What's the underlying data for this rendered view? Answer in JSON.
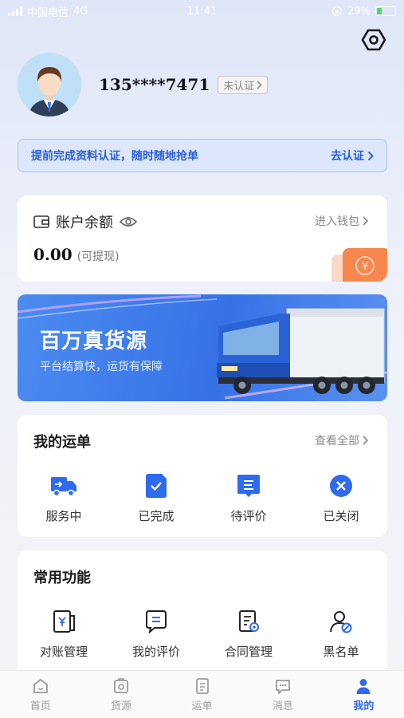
{
  "status": {
    "carrier": "中国电信",
    "network": "4G",
    "time": "11:41",
    "battery": "29%"
  },
  "profile": {
    "phone": "135****7471",
    "verify_label": "未认证"
  },
  "notice": {
    "text": "提前完成资料认证，随时随地抢单",
    "link": "去认证"
  },
  "balance": {
    "title": "账户余额",
    "wallet_link": "进入钱包",
    "amount": "0.00",
    "note": "(可提现)"
  },
  "banner": {
    "title": "百万真货源",
    "subtitle": "平台结算快，运货有保障"
  },
  "orders": {
    "title": "我的运单",
    "view_all": "查看全部",
    "items": [
      {
        "label": "服务中",
        "icon": "truck-icon"
      },
      {
        "label": "已完成",
        "icon": "check-doc-icon"
      },
      {
        "label": "待评价",
        "icon": "review-doc-icon"
      },
      {
        "label": "已关闭",
        "icon": "close-circle-icon"
      }
    ]
  },
  "functions": {
    "title": "常用功能",
    "items": [
      {
        "label": "对账管理",
        "icon": "ledger-icon"
      },
      {
        "label": "我的评价",
        "icon": "chat-icon"
      },
      {
        "label": "合同管理",
        "icon": "contract-icon"
      },
      {
        "label": "黑名单",
        "icon": "blacklist-user-icon"
      }
    ]
  },
  "tabs": [
    {
      "label": "首页",
      "icon": "home-icon"
    },
    {
      "label": "货源",
      "icon": "cargo-icon"
    },
    {
      "label": "运单",
      "icon": "waybill-icon"
    },
    {
      "label": "消息",
      "icon": "message-icon"
    },
    {
      "label": "我的",
      "icon": "profile-icon"
    }
  ],
  "colors": {
    "accent": "#2f6bef",
    "notice_bg": "#dce7fb",
    "banner": "#3672e6"
  }
}
